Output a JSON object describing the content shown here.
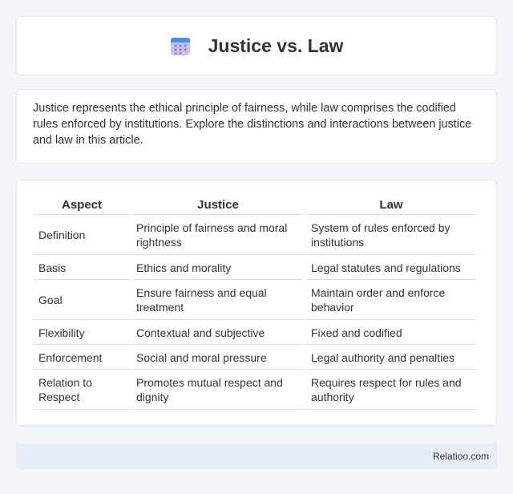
{
  "header": {
    "title": "Justice vs. Law",
    "icon": "calendar-icon",
    "accent": "#8e7cc3"
  },
  "intro": {
    "text": "Justice represents the ethical principle of fairness, while law comprises the codified rules enforced by institutions. Explore the distinctions and interactions between justice and law in this article."
  },
  "table": {
    "headers": [
      "Aspect",
      "Justice",
      "Law"
    ],
    "rows": [
      [
        "Definition",
        "Principle of fairness and moral rightness",
        "System of rules enforced by institutions"
      ],
      [
        "Basis",
        "Ethics and morality",
        "Legal statutes and regulations"
      ],
      [
        "Goal",
        "Ensure fairness and equal treatment",
        "Maintain order and enforce behavior"
      ],
      [
        "Flexibility",
        "Contextual and subjective",
        "Fixed and codified"
      ],
      [
        "Enforcement",
        "Social and moral pressure",
        "Legal authority and penalties"
      ],
      [
        "Relation to Respect",
        "Promotes mutual respect and dignity",
        "Requires respect for rules and authority"
      ]
    ]
  },
  "footer": {
    "brand": "Relatioo.com"
  }
}
